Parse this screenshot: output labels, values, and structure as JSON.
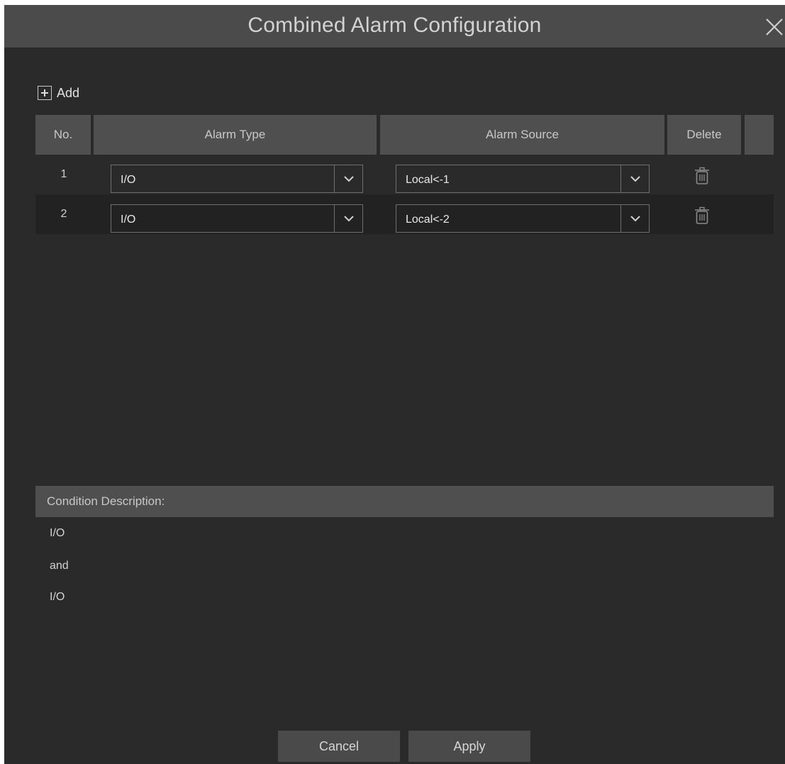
{
  "dialog": {
    "title": "Combined Alarm Configuration"
  },
  "toolbar": {
    "add_label": "Add"
  },
  "table": {
    "headers": {
      "no": "No.",
      "alarm_type": "Alarm Type",
      "alarm_source": "Alarm Source",
      "delete": "Delete"
    },
    "rows": [
      {
        "no": "1",
        "alarm_type": "I/O",
        "alarm_source": "Local<-1"
      },
      {
        "no": "2",
        "alarm_type": "I/O",
        "alarm_source": "Local<-2"
      }
    ]
  },
  "condition": {
    "header": "Condition Description:",
    "lines": [
      "I/O",
      "and",
      "I/O"
    ]
  },
  "footer": {
    "cancel_label": "Cancel",
    "apply_label": "Apply"
  },
  "icons": {
    "close": "close-icon",
    "add": "plus-box-icon",
    "dropdown": "chevron-down-icon",
    "delete": "trash-icon"
  },
  "colors": {
    "background": "#2a2a2a",
    "titlebar": "#4b4b4b",
    "header": "#4f4f4f",
    "text": "#d2d2d2"
  }
}
